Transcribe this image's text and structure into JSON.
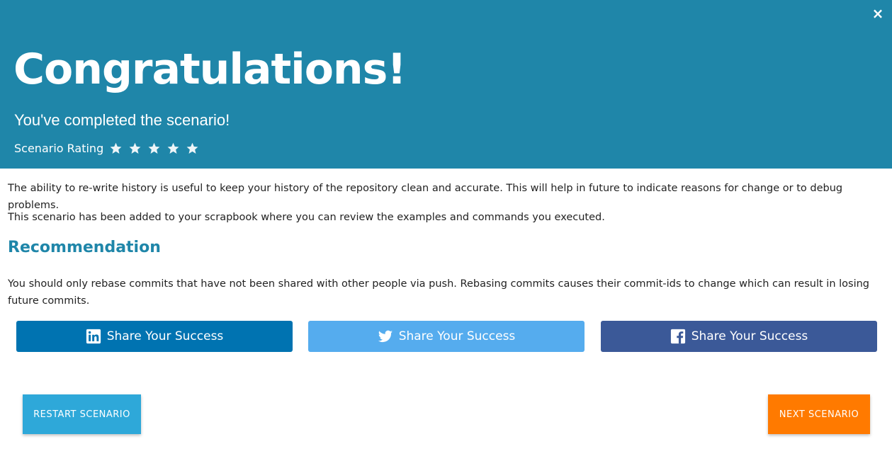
{
  "header": {
    "close_label": "×",
    "title": "Congratulations!",
    "subtitle": "You've completed the scenario!",
    "rating_label": "Scenario Rating",
    "rating_stars_total": 5,
    "background_color": "#1f86a9"
  },
  "content": {
    "paragraph_1": "The ability to re-write history is useful to keep your history of the repository clean and accurate. This will help in future to indicate reasons for change or to debug problems.",
    "paragraph_2": "This scenario has been added to your scrapbook where you can review the examples and commands you executed.",
    "recommendation_heading": "Recommendation",
    "recommendation_text": "You should only rebase commits that have not been shared with other people via push. Rebasing commits causes their commit-ids to change which can result in losing future commits."
  },
  "share": {
    "linkedin": {
      "label": "Share Your Success",
      "icon": "linkedin-icon",
      "color": "#0073b1"
    },
    "twitter": {
      "label": "Share Your Success",
      "icon": "twitter-icon",
      "color": "#55acee"
    },
    "facebook": {
      "label": "Share Your Success",
      "icon": "facebook-icon",
      "color": "#3b5998"
    }
  },
  "actions": {
    "restart_label": "RESTART SCENARIO",
    "next_label": "NEXT SCENARIO",
    "restart_color": "#2ea8d9",
    "next_color": "#ff7a00"
  }
}
